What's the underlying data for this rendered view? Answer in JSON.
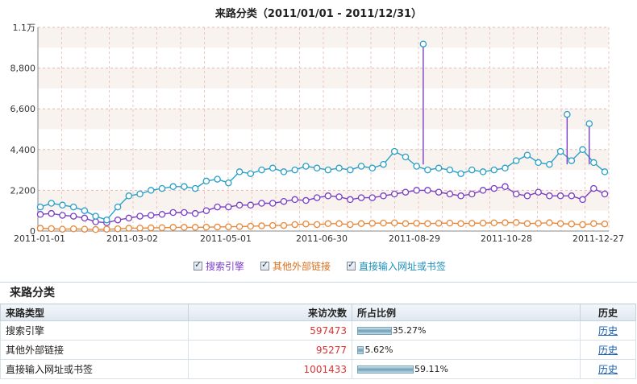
{
  "chart_data": {
    "type": "line",
    "title": "来路分类（2011/01/01 - 2011/12/31）",
    "y_ticks": [
      "0",
      "2,200",
      "4,400",
      "6,600",
      "8,800",
      "1.1万"
    ],
    "ylim": [
      0,
      11000
    ],
    "x_ticks": [
      "2011-01-01",
      "2011-03-02",
      "2011-05-01",
      "2011-06-30",
      "2011-08-29",
      "2011-10-28",
      "2011-12-27"
    ],
    "x_range": [
      "2011-01-01",
      "2011-12-31"
    ],
    "grid": true,
    "legend_position": "bottom",
    "series": [
      {
        "name": "搜索引擎",
        "color": "#7a3fc4",
        "values": [
          900,
          950,
          850,
          800,
          700,
          500,
          450,
          600,
          700,
          800,
          850,
          900,
          1000,
          1000,
          950,
          1100,
          1300,
          1300,
          1400,
          1400,
          1500,
          1500,
          1600,
          1700,
          1650,
          1800,
          1900,
          1850,
          1700,
          1800,
          1800,
          1900,
          2000,
          2100,
          2200,
          2200,
          2100,
          2000,
          1900,
          2000,
          2200,
          2300,
          2400,
          2000,
          1900,
          2100,
          1900,
          1900,
          1900,
          1700,
          2300,
          2000
        ]
      },
      {
        "name": "其他外部链接",
        "color": "#e8883a",
        "values": [
          150,
          130,
          100,
          120,
          100,
          80,
          100,
          120,
          150,
          160,
          170,
          180,
          200,
          200,
          200,
          210,
          220,
          230,
          240,
          260,
          280,
          300,
          300,
          350,
          380,
          350,
          400,
          400,
          350,
          400,
          420,
          430,
          440,
          400,
          420,
          400,
          420,
          430,
          400,
          420,
          430,
          440,
          450,
          460,
          400,
          420,
          450,
          400,
          380,
          350,
          400,
          380
        ]
      },
      {
        "name": "直接输入网址或书签",
        "color": "#2aa0c8",
        "values": [
          1300,
          1500,
          1400,
          1300,
          1100,
          800,
          600,
          1300,
          1900,
          2000,
          2200,
          2300,
          2400,
          2400,
          2300,
          2700,
          2800,
          2600,
          3200,
          3100,
          3300,
          3400,
          3200,
          3300,
          3500,
          3400,
          3300,
          3400,
          3300,
          3500,
          3400,
          3600,
          4300,
          4000,
          3500,
          3300,
          3400,
          3300,
          3100,
          3300,
          3200,
          3300,
          3400,
          3800,
          4100,
          3700,
          3600,
          4300,
          3800,
          4400,
          3700,
          3200
        ]
      },
      {
        "name": "直接输入网址或书签 spikes",
        "color": "#2aa0c8",
        "values": []
      }
    ],
    "annotations": []
  },
  "legend": [
    {
      "label": "搜索引擎",
      "color": "#7a3fc4"
    },
    {
      "label": "其他外部链接",
      "color": "#e8883a"
    },
    {
      "label": "直接输入网址或书签",
      "color": "#2aa0c8"
    }
  ],
  "section_title": "来路分类",
  "table": {
    "headers": {
      "type": "来路类型",
      "visits": "来访次数",
      "ratio": "所占比例",
      "history": "历史"
    },
    "rows": [
      {
        "type": "搜索引擎",
        "visits": "597473",
        "ratio": 35.27,
        "ratio_label": "35.27%",
        "history": "历史"
      },
      {
        "type": "其他外部链接",
        "visits": "95277",
        "ratio": 5.62,
        "ratio_label": "5.62%",
        "history": "历史"
      },
      {
        "type": "直接输入网址或书签",
        "visits": "1001433",
        "ratio": 59.11,
        "ratio_label": "59.11%",
        "history": "历史"
      }
    ]
  }
}
